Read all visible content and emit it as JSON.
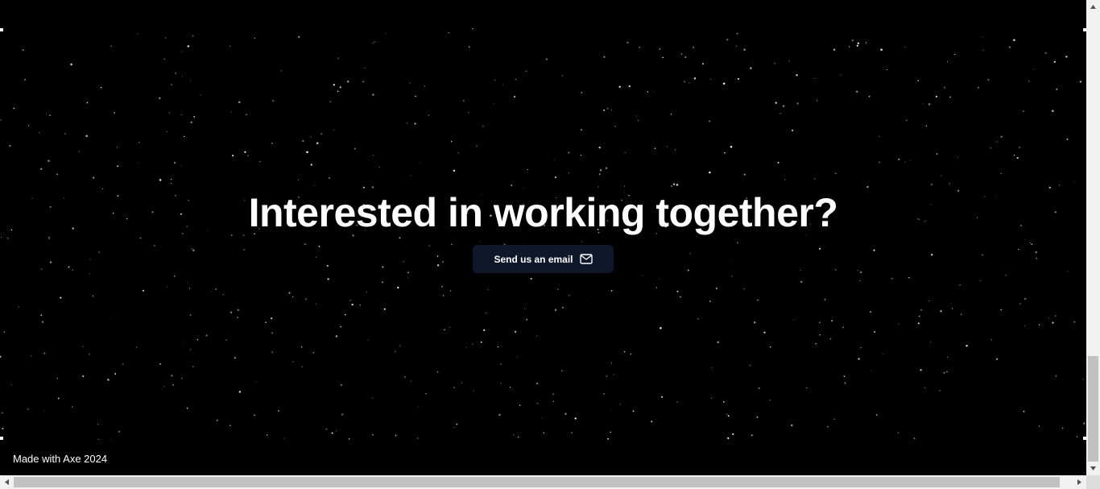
{
  "hero": {
    "headline": "Interested in working together?",
    "cta_label": "Send us an email",
    "cta_icon": "mail-icon"
  },
  "footer": {
    "text": "Made with Axe 2024"
  },
  "colors": {
    "background": "#000000",
    "headline": "#ffffff",
    "button_bg": "#0f172a",
    "button_text": "#ffffff",
    "scrollbar_track": "#f1f1f1",
    "scrollbar_thumb": "#c1c1c1"
  }
}
